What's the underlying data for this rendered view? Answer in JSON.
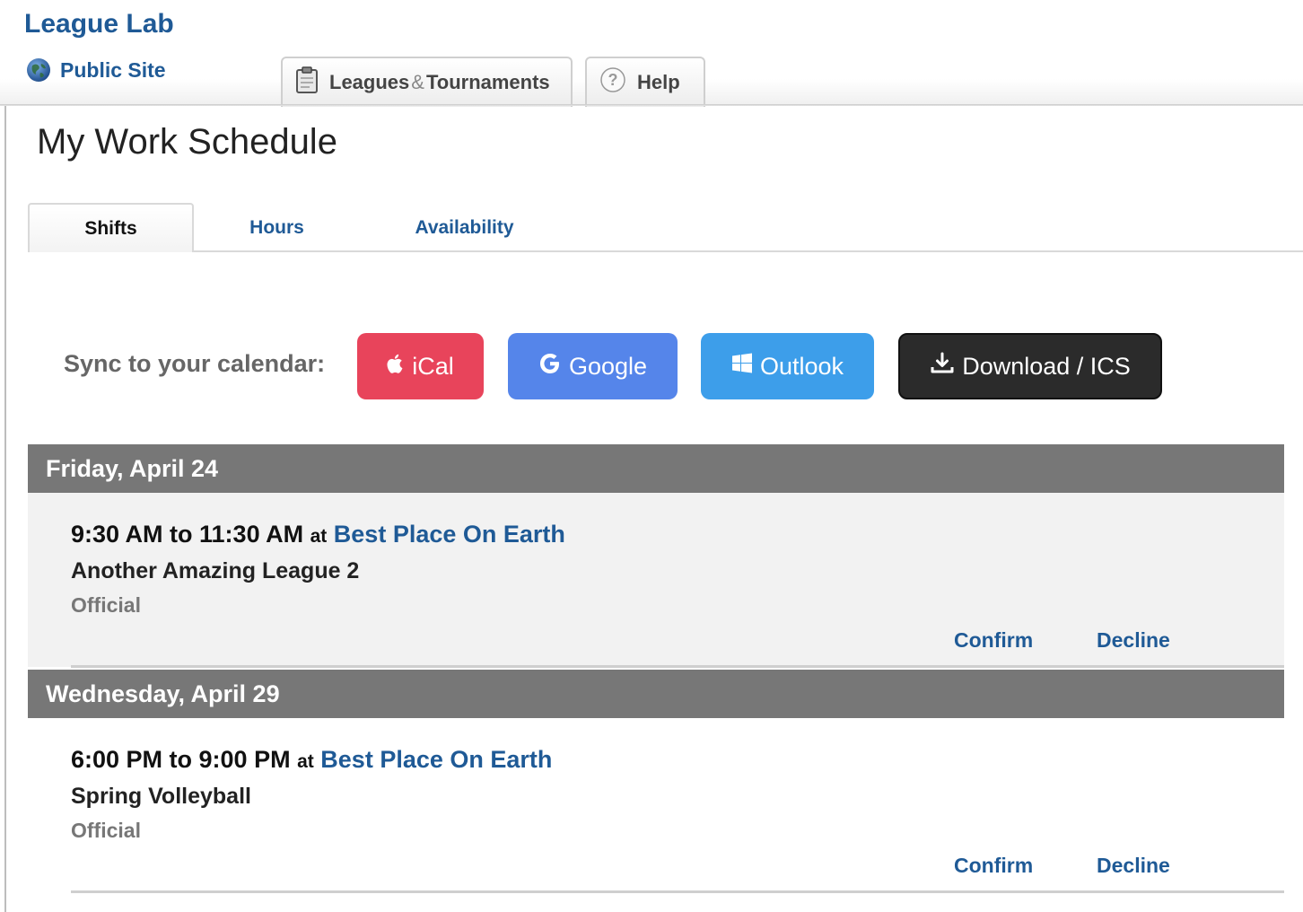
{
  "header": {
    "brand": "League Lab",
    "public_site": "Public Site",
    "tabs": [
      {
        "label": "Leagues",
        "amp": "&",
        "label2": "Tournaments"
      },
      {
        "label": "Help"
      }
    ]
  },
  "page": {
    "title": "My Work Schedule",
    "sub_tabs": [
      "Shifts",
      "Hours",
      "Availability"
    ],
    "active_sub_tab": "Shifts"
  },
  "sync": {
    "label": "Sync to your calendar:",
    "buttons": [
      {
        "label": "iCal",
        "icon": "apple-icon",
        "color": "#e8445b"
      },
      {
        "label": "Google",
        "icon": "google-icon",
        "color": "#5585ea"
      },
      {
        "label": "Outlook",
        "icon": "windows-icon",
        "color": "#3d9eea"
      },
      {
        "label": "Download / ICS",
        "icon": "download-icon",
        "color": "#2b2b2b"
      }
    ]
  },
  "days": [
    {
      "date": "Friday, April 24",
      "shift": {
        "time": "9:30 AM to 11:30 AM",
        "at": "at",
        "venue": "Best Place On Earth",
        "league": "Another Amazing League 2",
        "role": "Official",
        "confirm": "Confirm",
        "decline": "Decline"
      }
    },
    {
      "date": "Wednesday, April 29",
      "shift": {
        "time": "6:00 PM to 9:00 PM",
        "at": "at",
        "venue": "Best Place On Earth",
        "league": "Spring Volleyball",
        "role": "Official",
        "confirm": "Confirm",
        "decline": "Decline"
      }
    }
  ],
  "colors": {
    "link": "#1f5a96",
    "day_header_bg": "#777777",
    "shaded_row_bg": "#f2f2f2"
  }
}
